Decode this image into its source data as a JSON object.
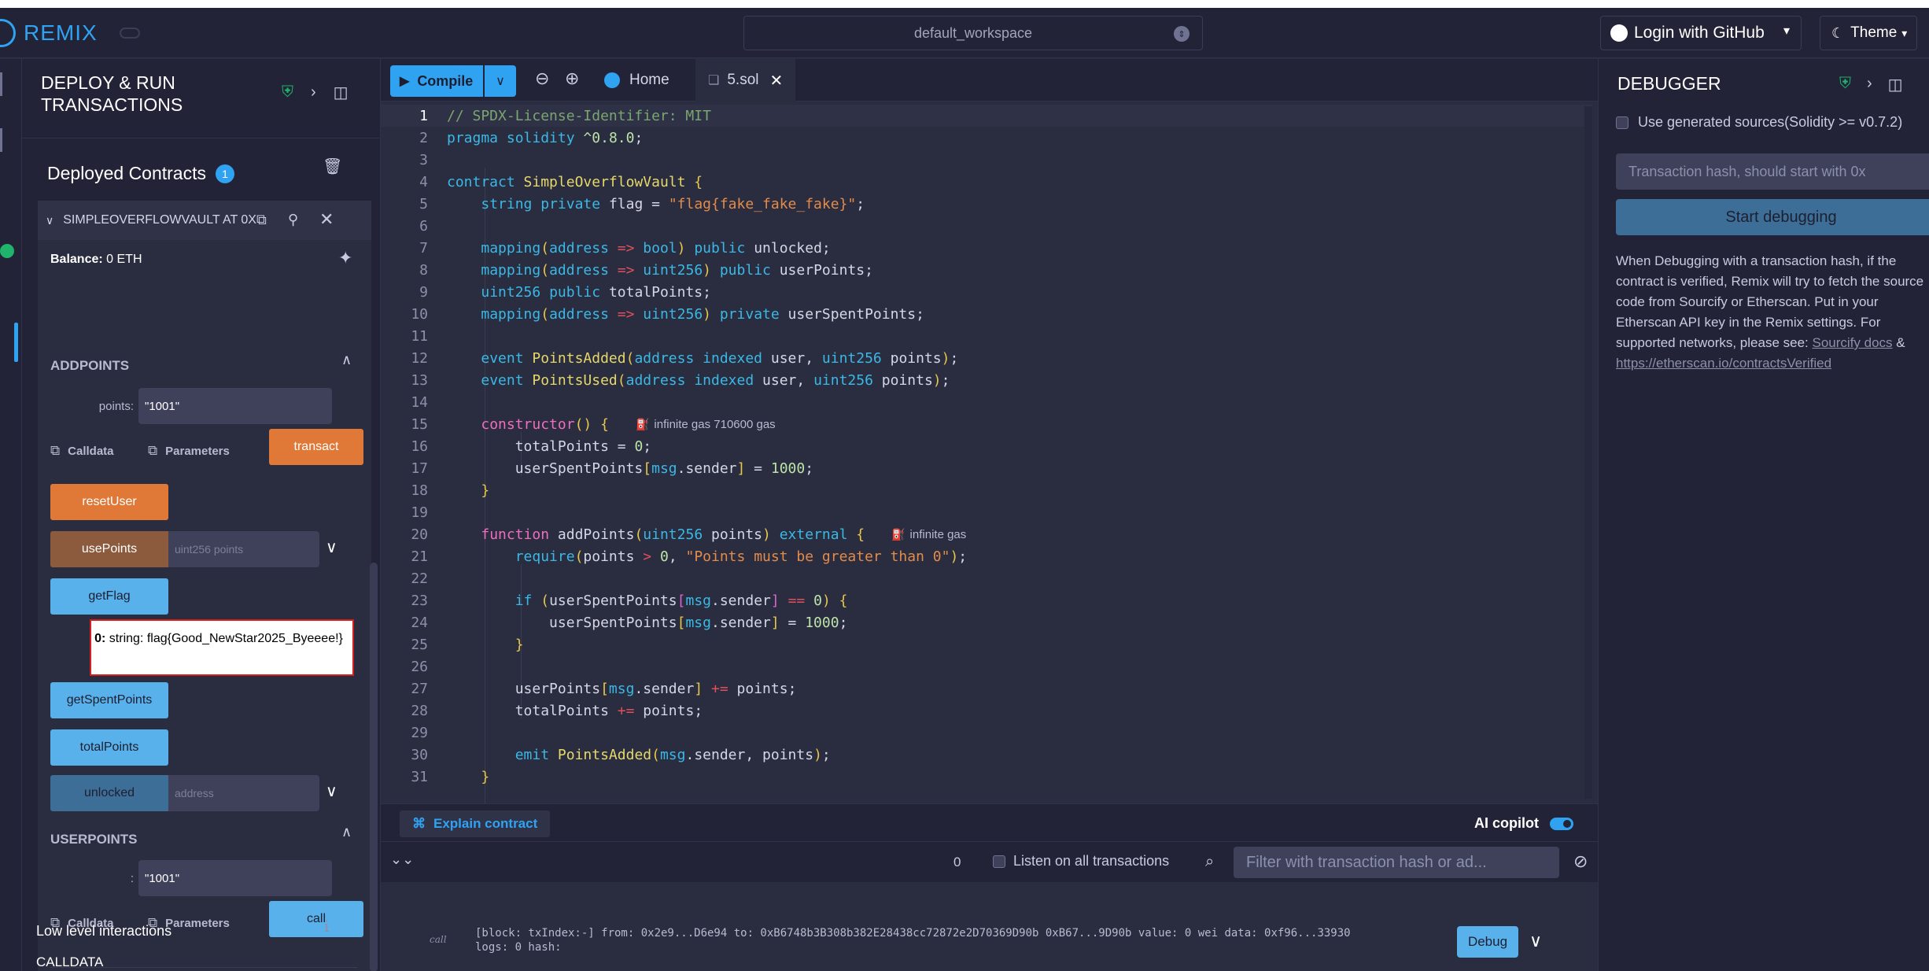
{
  "topbar": {
    "logo": "REMIX",
    "workspace": "default_workspace",
    "github": "Login with GitHub",
    "theme": "Theme"
  },
  "left": {
    "title": "DEPLOY & RUN TRANSACTIONS",
    "deployed_label": "Deployed Contracts",
    "deployed_count": "1",
    "contract": {
      "name": "SIMPLEOVERFLOWVAULT AT 0X",
      "balance_label": "Balance:",
      "balance_value": "0 ETH",
      "addpoints_section": "ADDPOINTS",
      "points_label": "points:",
      "points_value": "\"1001\"",
      "calldata": "Calldata",
      "parameters": "Parameters",
      "transact": "transact",
      "reset_user": "resetUser",
      "use_points": "usePoints",
      "use_points_placeholder": "uint256 points",
      "get_flag": "getFlag",
      "result_prefix": "0:",
      "result_text": "string: flag{Good_NewStar2025_Byeeee!}",
      "get_spent_points": "getSpentPoints",
      "total_points": "totalPoints",
      "unlocked": "unlocked",
      "unlocked_placeholder": "address",
      "userpoints_section": "USERPOINTS",
      "userpoints_label": ":",
      "userpoints_value": "\"1001\"",
      "call": "call",
      "low_level": "Low level interactions",
      "calldata_label": "CALLDATA"
    }
  },
  "editor": {
    "compile": "Compile",
    "tab_home": "Home",
    "tab_file": "5.sol",
    "gas_constructor": "infinite gas 710600 gas",
    "gas_addpoints": "infinite gas",
    "explain": "Explain contract",
    "copilot": "AI copilot",
    "term_count": "0",
    "listen": "Listen on all transactions",
    "filter_placeholder": "Filter with transaction hash or ad...",
    "log_line1": "[block: txIndex:-] from: 0x2e9...D6e94 to: 0xB6748b3B308b382E28438cc72872e2D70369D90b 0xB67...9D90b value: 0 wei data: 0xf96...33930",
    "log_line2": "logs: 0 hash:",
    "debug": "Debug",
    "log_icon": "call"
  },
  "right": {
    "title": "DEBUGGER",
    "use_generated": "Use generated sources(Solidity >= v0.7.2)",
    "txhash_placeholder": "Transaction hash, should start with 0x",
    "start": "Start debugging",
    "desc": "When Debugging with a transaction hash, if the contract is verified, Remix will try to fetch the source code from Sourcify or Etherscan. Put in your Etherscan API key in the Remix settings. For supported networks, please see:",
    "link1": "Sourcify docs",
    "link_sep": "&",
    "link2": "https://etherscan.io/contractsVerified"
  },
  "code_lines": [
    "// SPDX-License-Identifier: MIT",
    "pragma solidity ^0.8.0;",
    "",
    "contract SimpleOverflowVault {",
    "    string private flag = \"flag{fake_fake_fake}\";",
    "",
    "    mapping(address => bool) public unlocked;",
    "    mapping(address => uint256) public userPoints;",
    "    uint256 public totalPoints;",
    "    mapping(address => uint256) private userSpentPoints;",
    "",
    "    event PointsAdded(address indexed user, uint256 points);",
    "    event PointsUsed(address indexed user, uint256 points);",
    "",
    "    constructor() {",
    "        totalPoints = 0;",
    "        userSpentPoints[msg.sender] = 1000;",
    "    }",
    "",
    "    function addPoints(uint256 points) external {",
    "        require(points > 0, \"Points must be greater than 0\");",
    "",
    "        if (userSpentPoints[msg.sender] == 0) {",
    "            userSpentPoints[msg.sender] = 1000;",
    "        }",
    "",
    "        userPoints[msg.sender] += points;",
    "        totalPoints += points;",
    "",
    "        emit PointsAdded(msg.sender, points);",
    "    }"
  ],
  "colors": {
    "accent": "#2fa3f2",
    "transact": "#e07938",
    "call": "#58b1ea",
    "highlight_border": "#d51f1f"
  }
}
